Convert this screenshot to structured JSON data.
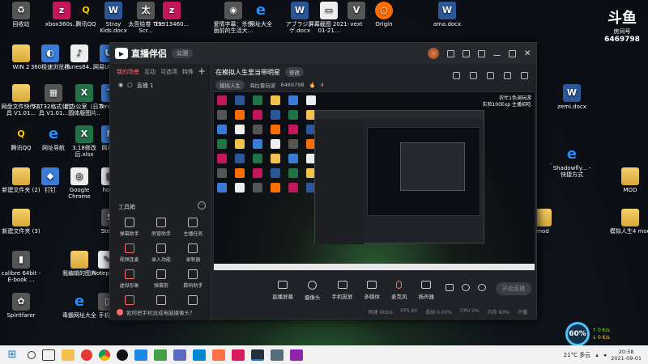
{
  "desktop": {
    "icons": [
      {
        "label": "回收站",
        "type": "gray",
        "glyph": "♻"
      },
      {
        "label": "xbox360s...",
        "type": "app",
        "glyph": "z"
      },
      {
        "label": "腾讯QQ",
        "type": "qq",
        "glyph": "Q"
      },
      {
        "label": "Stray Kids.docx",
        "type": "word",
        "glyph": "W"
      },
      {
        "label": "太吾绘卷 The Scr...",
        "type": "gray",
        "glyph": "太"
      },
      {
        "label": "15913460...",
        "type": "app",
        "glyph": "z"
      },
      {
        "label": "WIN 2",
        "type": "folder",
        "glyph": ""
      },
      {
        "label": "360极速浏览器",
        "type": "blue",
        "glyph": "◐"
      },
      {
        "label": "iTunes64...",
        "type": "white",
        "glyph": "♪"
      },
      {
        "label": "网易UU加...",
        "type": "blue",
        "glyph": "U"
      },
      {
        "label": "网盘文件快传工具 V1.01...",
        "type": "folder",
        "glyph": ""
      },
      {
        "label": "FAT32格式化工具 V1.01...",
        "type": "gray",
        "glyph": "▦"
      },
      {
        "label": "新办公室（日本圆体版图片..",
        "type": "excel",
        "glyph": "X"
      },
      {
        "label": "Tencent",
        "type": "blue",
        "glyph": "T"
      },
      {
        "label": "腾讯QQ",
        "type": "qq",
        "glyph": "Q"
      },
      {
        "label": "网址导航",
        "type": "ie",
        "glyph": "e"
      },
      {
        "label": "3.18修改后.xlsx",
        "type": "excel",
        "glyph": "X"
      },
      {
        "label": "网易...",
        "type": "blue",
        "glyph": "N"
      },
      {
        "label": "新建文件夹 (2)",
        "type": "folder",
        "glyph": ""
      },
      {
        "label": "钉钉",
        "type": "blue",
        "glyph": "◆"
      },
      {
        "label": "Google Chrome",
        "type": "white",
        "glyph": "◎"
      },
      {
        "label": "hosts",
        "type": "white",
        "glyph": "▤"
      },
      {
        "label": "新建文件夹 (3)",
        "type": "folder",
        "glyph": ""
      },
      {
        "label": "calibre 64bit - E-book ...",
        "type": "gray",
        "glyph": "▮"
      },
      {
        "label": "我编辑的图片",
        "type": "folder",
        "glyph": ""
      },
      {
        "label": "Notepad...",
        "type": "white",
        "glyph": "✎"
      },
      {
        "label": "Steam",
        "type": "gray",
        "glyph": "S"
      },
      {
        "label": "Spiritfarer",
        "type": "gray",
        "glyph": "✿"
      },
      {
        "label": "毒霸网址大全",
        "type": "ie",
        "glyph": "e"
      },
      {
        "label": "手机...",
        "type": "gray",
        "glyph": "▯"
      },
      {
        "label": "爱情字幕：杀伤面前的生活大...",
        "type": "gray",
        "glyph": "◉"
      },
      {
        "label": "网址大全",
        "type": "ie",
        "glyph": "e"
      },
      {
        "label": "アブラジン ゲ.docx",
        "type": "word",
        "glyph": "W"
      },
      {
        "label": "屏幕截图 2021-01-21...",
        "type": "white",
        "glyph": "▭"
      },
      {
        "label": "vext",
        "type": "gray",
        "glyph": "V"
      },
      {
        "label": "Origin",
        "type": "orange",
        "glyph": "○"
      },
      {
        "label": "ama.docx",
        "type": "word",
        "glyph": "W"
      },
      {
        "label": "zemi.docx",
        "type": "word",
        "glyph": "W"
      },
      {
        "label": "Shadowfly... - 快捷方式",
        "type": "ie",
        "glyph": "e"
      },
      {
        "label": "MOD",
        "type": "folder",
        "glyph": ""
      },
      {
        "label": "模拟人生4 mod",
        "type": "folder",
        "glyph": ""
      },
      {
        "label": "mod",
        "type": "folder",
        "glyph": ""
      }
    ]
  },
  "room_badge": {
    "logo": "斗鱼",
    "sub": "房间号",
    "number": "6469798"
  },
  "app": {
    "brand": "直播伴侣",
    "brand_tag": "公测",
    "sidebar": {
      "tabs": [
        "我的场景",
        "互动",
        "可选项",
        "特殊"
      ],
      "scene": "直播 1",
      "tools_title": "工具箱",
      "tools": [
        "弹幕助手",
        "房管助手",
        "主播任务",
        "视频连麦",
        "录入功能",
        "录制器",
        "虚拟形象",
        "弹幕剪",
        "数码助手",
        "",
        "",
        ""
      ],
      "tip": "如何把手机设成电脑摄像头？"
    },
    "stream": {
      "title": "在模拟人生里当带明星",
      "edit_label": "修改",
      "category": "模拟人生",
      "meta_prefix": "海拉鲁玩家",
      "room_id": "6469798",
      "heat": "4"
    },
    "preview_caption_line1": "农忙1色调玩游",
    "preview_caption_line2": "实验100Exp 主播招吃",
    "controls": [
      "直播屏幕",
      "摄像头",
      "手机投屏",
      "多媒体",
      "麦克风",
      "扬声器"
    ],
    "go_live": "开始直播",
    "status": [
      "网速 0kb/s",
      "FPS 60",
      "丢帧 0.00%",
      "CPU 0%",
      "内存 60%",
      "开播"
    ]
  },
  "perf_widget": {
    "percent": "60%",
    "up": "0 K/s",
    "down": "0 K/s"
  },
  "taskbar": {
    "weather": "21°C 多云",
    "clock_time": "20:58",
    "clock_date": "2021-09-01"
  }
}
